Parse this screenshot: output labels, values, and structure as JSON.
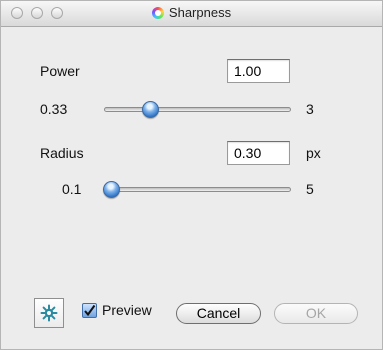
{
  "window": {
    "title": "Sharpness"
  },
  "power": {
    "label": "Power",
    "value": "1.00",
    "slider": {
      "min_label": "0.33",
      "max_label": "3",
      "min": 0.33,
      "max": 3,
      "value": 1.0
    }
  },
  "radius": {
    "label": "Radius",
    "value": "0.30",
    "unit": "px",
    "slider": {
      "min_label": "0.1",
      "max_label": "5",
      "min": 0.1,
      "max": 5,
      "value": 0.3
    }
  },
  "footer": {
    "preview_label": "Preview",
    "preview_checked": true,
    "cancel_label": "Cancel",
    "ok_label": "OK",
    "ok_enabled": false
  },
  "icons": {
    "settings_icon": "gear-icon",
    "check_icon": "checkmark-icon",
    "app_icon": "color-wheel-icon"
  },
  "colors": {
    "knob": "#2f74c9",
    "settings_icon": "#2a8aa0"
  }
}
